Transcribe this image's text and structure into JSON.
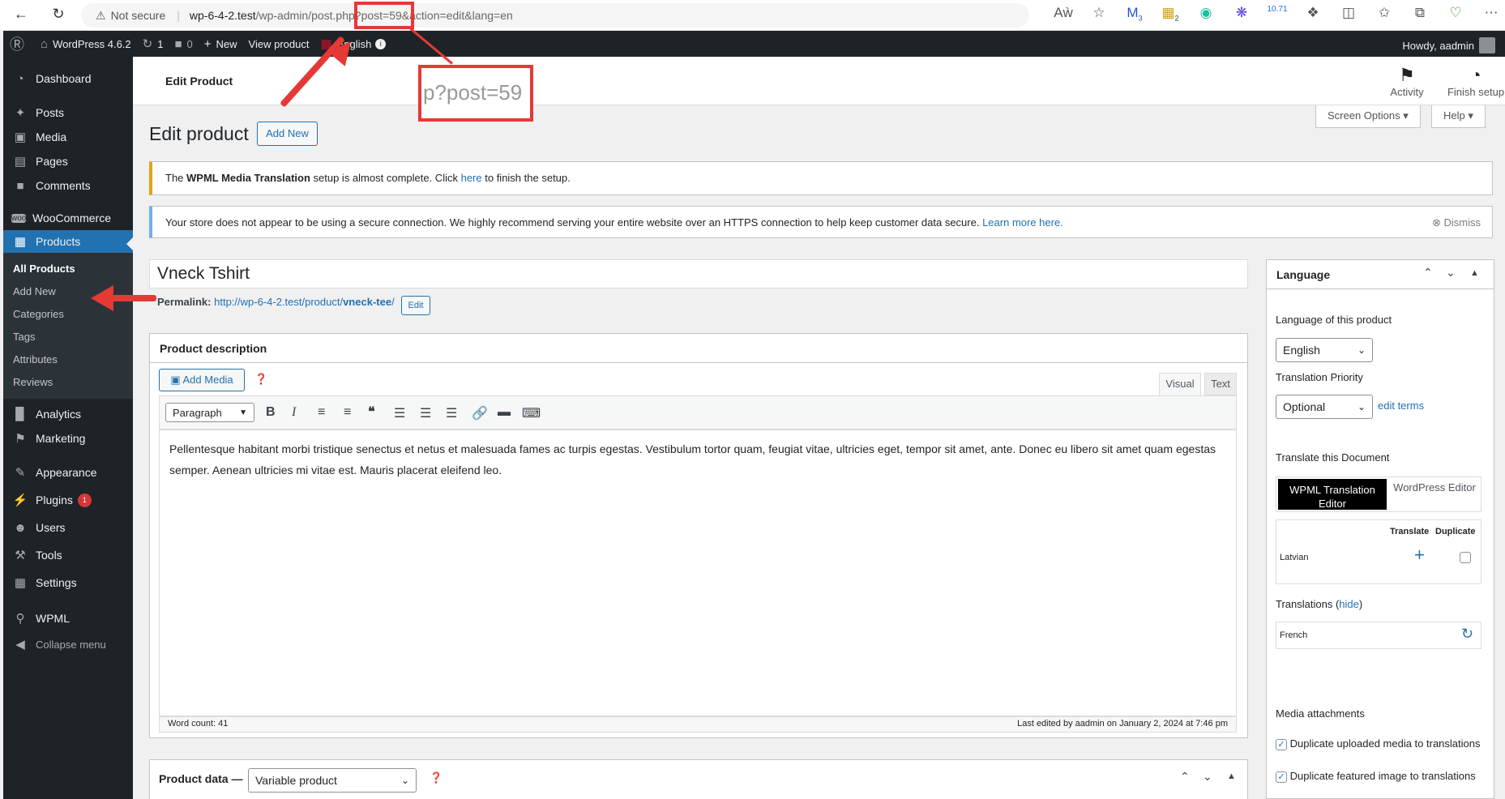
{
  "browser": {
    "not_secure": "Not secure",
    "url_host": "wp-6-4-2.test",
    "url_path": "/wp-admin/post.php?post=59&action=edit&lang=en",
    "ext_badge1": "3",
    "ext_badge2": "2",
    "ext_badge3": "10.71"
  },
  "adminbar": {
    "site": "WordPress 4.6.2",
    "updates": "1",
    "comments": "0",
    "new": "New",
    "view": "View product",
    "lang": "English",
    "howdy": "Howdy, aadmin"
  },
  "menu": {
    "dashboard": "Dashboard",
    "posts": "Posts",
    "media": "Media",
    "pages": "Pages",
    "comments": "Comments",
    "woocommerce": "WooCommerce",
    "products": "Products",
    "sub": [
      "All Products",
      "Add New",
      "Categories",
      "Tags",
      "Attributes",
      "Reviews"
    ],
    "analytics": "Analytics",
    "marketing": "Marketing",
    "appearance": "Appearance",
    "plugins": "Plugins",
    "plugins_badge": "1",
    "users": "Users",
    "tools": "Tools",
    "settings": "Settings",
    "wpml": "WPML",
    "collapse": "Collapse menu"
  },
  "header": {
    "title": "Edit Product",
    "activity": "Activity",
    "finish": "Finish setup",
    "screen_options": "Screen Options",
    "help": "Help"
  },
  "page": {
    "heading": "Edit product",
    "add_new": "Add New",
    "zoom_text": "p?post=59"
  },
  "notices": {
    "wpml_pre": "The ",
    "wpml_bold": "WPML Media Translation",
    "wpml_mid": " setup is almost complete. Click ",
    "wpml_link": "here",
    "wpml_post": " to finish the setup.",
    "https_text": "Your store does not appear to be using a secure connection. We highly recommend serving your entire website over an HTTPS connection to help keep customer data secure.",
    "https_link": "Learn more here.",
    "dismiss": "Dismiss"
  },
  "product": {
    "title": "Vneck Tshirt",
    "permalink_label": "Permalink:",
    "permalink_base": "http://wp-6-4-2.test/product/",
    "permalink_slug": "vneck-tee",
    "permalink_end": "/",
    "edit": "Edit"
  },
  "editor": {
    "box_title": "Product description",
    "add_media": "Add Media",
    "visual": "Visual",
    "text": "Text",
    "format": "Paragraph",
    "content": "Pellentesque habitant morbi tristique senectus et netus et malesuada fames ac turpis egestas. Vestibulum tortor quam, feugiat vitae, ultricies eget, tempor sit amet, ante. Donec eu libero sit amet quam egestas semper. Aenean ultricies mi vitae est. Mauris placerat eleifend leo.",
    "word_count": "Word count: 41",
    "last_edited": "Last edited by aadmin on January 2, 2024 at 7:46 pm"
  },
  "product_data": {
    "label": "Product data —",
    "type": "Variable product"
  },
  "language_box": {
    "title": "Language",
    "lang_label": "Language of this product",
    "lang_value": "English",
    "priority_label": "Translation Priority",
    "priority_value": "Optional",
    "edit_terms": "edit terms",
    "translate_label": "Translate this Document",
    "tab_wpml": "WPML Translation Editor",
    "tab_wp": "WordPress Editor",
    "col_translate": "Translate",
    "col_duplicate": "Duplicate",
    "row_lang": "Latvian",
    "translations_label": "Translations",
    "hide": "hide",
    "trans_lang": "French",
    "media_label": "Media attachments",
    "dup_media": "Duplicate uploaded media to translations",
    "dup_featured": "Duplicate featured image to translations"
  }
}
